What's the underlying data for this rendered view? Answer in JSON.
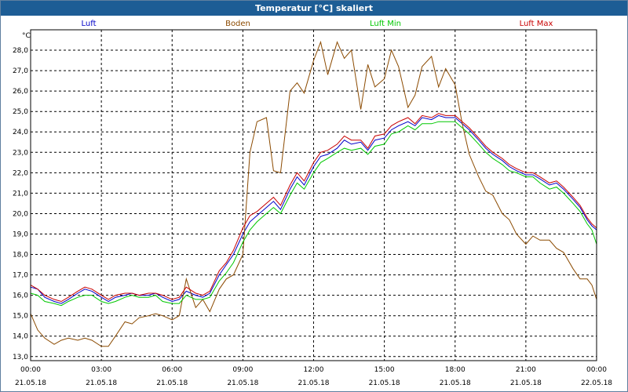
{
  "window": {
    "title": "Temperatur [°C] skaliert"
  },
  "chart_data": {
    "type": "line",
    "title": "Temperatur [°C] skaliert",
    "ylabel": "°C",
    "xlabel": "",
    "ylim": [
      12.8,
      29.0
    ],
    "xlim": [
      0,
      24
    ],
    "grid": true,
    "legend_position": "top",
    "y_ticks": [
      "13,0",
      "14,0",
      "15,0",
      "16,0",
      "17,0",
      "18,0",
      "19,0",
      "20,0",
      "21,0",
      "22,0",
      "23,0",
      "24,0",
      "25,0",
      "26,0",
      "27,0",
      "28,0"
    ],
    "x_ticks": [
      {
        "time": "00:00",
        "date": "21.05.18"
      },
      {
        "time": "03:00",
        "date": "21.05.18"
      },
      {
        "time": "06:00",
        "date": "21.05.18"
      },
      {
        "time": "09:00",
        "date": "21.05.18"
      },
      {
        "time": "12:00",
        "date": "21.05.18"
      },
      {
        "time": "15:00",
        "date": "21.05.18"
      },
      {
        "time": "18:00",
        "date": "21.05.18"
      },
      {
        "time": "21:00",
        "date": "21.05.18"
      },
      {
        "time": "00:00",
        "date": "22.05.18"
      }
    ],
    "series": [
      {
        "name": "Luft",
        "color": "#0000c8",
        "points": [
          [
            0,
            16.4
          ],
          [
            0.3,
            16.3
          ],
          [
            0.6,
            15.9
          ],
          [
            1.0,
            15.7
          ],
          [
            1.3,
            15.6
          ],
          [
            1.6,
            15.8
          ],
          [
            2.0,
            16.1
          ],
          [
            2.3,
            16.3
          ],
          [
            2.6,
            16.2
          ],
          [
            3.0,
            15.9
          ],
          [
            3.3,
            15.7
          ],
          [
            3.6,
            15.9
          ],
          [
            4.0,
            16.0
          ],
          [
            4.3,
            16.1
          ],
          [
            4.6,
            16.0
          ],
          [
            5.0,
            16.0
          ],
          [
            5.3,
            16.1
          ],
          [
            5.6,
            15.9
          ],
          [
            6.0,
            15.7
          ],
          [
            6.3,
            15.8
          ],
          [
            6.6,
            16.2
          ],
          [
            7.0,
            16.0
          ],
          [
            7.3,
            15.9
          ],
          [
            7.6,
            16.1
          ],
          [
            8.0,
            17.0
          ],
          [
            8.3,
            17.5
          ],
          [
            8.6,
            18.0
          ],
          [
            9.0,
            19.0
          ],
          [
            9.3,
            19.6
          ],
          [
            9.6,
            19.9
          ],
          [
            10.0,
            20.3
          ],
          [
            10.3,
            20.6
          ],
          [
            10.6,
            20.2
          ],
          [
            11.0,
            21.2
          ],
          [
            11.3,
            21.8
          ],
          [
            11.6,
            21.4
          ],
          [
            12.0,
            22.3
          ],
          [
            12.3,
            22.8
          ],
          [
            12.6,
            22.9
          ],
          [
            13.0,
            23.2
          ],
          [
            13.3,
            23.6
          ],
          [
            13.6,
            23.4
          ],
          [
            14.0,
            23.5
          ],
          [
            14.3,
            23.1
          ],
          [
            14.6,
            23.6
          ],
          [
            15.0,
            23.7
          ],
          [
            15.3,
            24.1
          ],
          [
            15.6,
            24.3
          ],
          [
            16.0,
            24.5
          ],
          [
            16.3,
            24.3
          ],
          [
            16.6,
            24.7
          ],
          [
            17.0,
            24.6
          ],
          [
            17.3,
            24.8
          ],
          [
            17.6,
            24.7
          ],
          [
            18.0,
            24.7
          ],
          [
            18.3,
            24.4
          ],
          [
            18.6,
            24.1
          ],
          [
            19.0,
            23.6
          ],
          [
            19.3,
            23.2
          ],
          [
            19.6,
            22.9
          ],
          [
            20.0,
            22.6
          ],
          [
            20.3,
            22.3
          ],
          [
            20.6,
            22.1
          ],
          [
            21.0,
            21.9
          ],
          [
            21.3,
            21.9
          ],
          [
            21.6,
            21.7
          ],
          [
            22.0,
            21.4
          ],
          [
            22.3,
            21.5
          ],
          [
            22.6,
            21.2
          ],
          [
            23.0,
            20.7
          ],
          [
            23.3,
            20.3
          ],
          [
            23.6,
            19.7
          ],
          [
            23.8,
            19.4
          ],
          [
            24.0,
            19.2
          ]
        ]
      },
      {
        "name": "Boden",
        "color": "#8b4a00",
        "points": [
          [
            0,
            15.1
          ],
          [
            0.3,
            14.3
          ],
          [
            0.6,
            13.9
          ],
          [
            1.0,
            13.6
          ],
          [
            1.3,
            13.8
          ],
          [
            1.6,
            13.9
          ],
          [
            2.0,
            13.8
          ],
          [
            2.3,
            13.9
          ],
          [
            2.6,
            13.8
          ],
          [
            3.0,
            13.5
          ],
          [
            3.3,
            13.5
          ],
          [
            3.6,
            14.0
          ],
          [
            4.0,
            14.7
          ],
          [
            4.3,
            14.6
          ],
          [
            4.6,
            14.9
          ],
          [
            5.0,
            15.0
          ],
          [
            5.3,
            15.1
          ],
          [
            5.6,
            15.0
          ],
          [
            6.0,
            14.8
          ],
          [
            6.3,
            15.0
          ],
          [
            6.6,
            16.8
          ],
          [
            7.0,
            15.4
          ],
          [
            7.3,
            15.8
          ],
          [
            7.6,
            15.2
          ],
          [
            8.0,
            16.3
          ],
          [
            8.3,
            16.8
          ],
          [
            8.6,
            17.0
          ],
          [
            9.0,
            18.0
          ],
          [
            9.3,
            23.0
          ],
          [
            9.6,
            24.5
          ],
          [
            10.0,
            24.7
          ],
          [
            10.3,
            22.1
          ],
          [
            10.6,
            22.0
          ],
          [
            11.0,
            26.0
          ],
          [
            11.3,
            26.4
          ],
          [
            11.6,
            25.9
          ],
          [
            12.0,
            27.5
          ],
          [
            12.3,
            28.4
          ],
          [
            12.6,
            26.8
          ],
          [
            13.0,
            28.4
          ],
          [
            13.3,
            27.6
          ],
          [
            13.6,
            28.0
          ],
          [
            14.0,
            25.1
          ],
          [
            14.3,
            27.3
          ],
          [
            14.6,
            26.2
          ],
          [
            15.0,
            26.6
          ],
          [
            15.3,
            28.0
          ],
          [
            15.6,
            27.2
          ],
          [
            16.0,
            25.2
          ],
          [
            16.3,
            25.8
          ],
          [
            16.6,
            27.2
          ],
          [
            17.0,
            27.7
          ],
          [
            17.3,
            26.2
          ],
          [
            17.6,
            27.1
          ],
          [
            18.0,
            26.3
          ],
          [
            18.3,
            24.4
          ],
          [
            18.6,
            22.9
          ],
          [
            19.0,
            21.8
          ],
          [
            19.3,
            21.1
          ],
          [
            19.6,
            20.9
          ],
          [
            20.0,
            20.0
          ],
          [
            20.3,
            19.7
          ],
          [
            20.6,
            19.0
          ],
          [
            21.0,
            18.5
          ],
          [
            21.3,
            18.9
          ],
          [
            21.6,
            18.7
          ],
          [
            22.0,
            18.7
          ],
          [
            22.3,
            18.3
          ],
          [
            22.6,
            18.1
          ],
          [
            23.0,
            17.3
          ],
          [
            23.3,
            16.8
          ],
          [
            23.6,
            16.8
          ],
          [
            23.8,
            16.5
          ],
          [
            24.0,
            15.8
          ]
        ]
      },
      {
        "name": "Luft Min",
        "color": "#00c800",
        "points": [
          [
            0,
            16.1
          ],
          [
            0.3,
            16.0
          ],
          [
            0.6,
            15.7
          ],
          [
            1.0,
            15.6
          ],
          [
            1.3,
            15.5
          ],
          [
            1.6,
            15.7
          ],
          [
            2.0,
            15.9
          ],
          [
            2.3,
            16.0
          ],
          [
            2.6,
            16.0
          ],
          [
            3.0,
            15.7
          ],
          [
            3.3,
            15.6
          ],
          [
            3.6,
            15.7
          ],
          [
            4.0,
            15.9
          ],
          [
            4.3,
            16.0
          ],
          [
            4.6,
            15.9
          ],
          [
            5.0,
            15.9
          ],
          [
            5.3,
            16.0
          ],
          [
            5.6,
            15.7
          ],
          [
            6.0,
            15.6
          ],
          [
            6.3,
            15.6
          ],
          [
            6.6,
            16.0
          ],
          [
            7.0,
            15.8
          ],
          [
            7.3,
            15.8
          ],
          [
            7.6,
            15.9
          ],
          [
            8.0,
            16.7
          ],
          [
            8.3,
            17.1
          ],
          [
            8.6,
            17.6
          ],
          [
            9.0,
            18.6
          ],
          [
            9.3,
            19.2
          ],
          [
            9.6,
            19.6
          ],
          [
            10.0,
            20.0
          ],
          [
            10.3,
            20.3
          ],
          [
            10.6,
            20.0
          ],
          [
            11.0,
            20.9
          ],
          [
            11.3,
            21.5
          ],
          [
            11.6,
            21.2
          ],
          [
            12.0,
            22.0
          ],
          [
            12.3,
            22.5
          ],
          [
            12.6,
            22.7
          ],
          [
            13.0,
            23.0
          ],
          [
            13.3,
            23.2
          ],
          [
            13.6,
            23.1
          ],
          [
            14.0,
            23.2
          ],
          [
            14.3,
            22.9
          ],
          [
            14.6,
            23.3
          ],
          [
            15.0,
            23.4
          ],
          [
            15.3,
            23.9
          ],
          [
            15.6,
            24.0
          ],
          [
            16.0,
            24.3
          ],
          [
            16.3,
            24.1
          ],
          [
            16.6,
            24.4
          ],
          [
            17.0,
            24.4
          ],
          [
            17.3,
            24.5
          ],
          [
            17.6,
            24.5
          ],
          [
            18.0,
            24.5
          ],
          [
            18.3,
            24.2
          ],
          [
            18.6,
            23.9
          ],
          [
            19.0,
            23.4
          ],
          [
            19.3,
            23.0
          ],
          [
            19.6,
            22.7
          ],
          [
            20.0,
            22.4
          ],
          [
            20.3,
            22.1
          ],
          [
            20.6,
            22.0
          ],
          [
            21.0,
            21.8
          ],
          [
            21.3,
            21.8
          ],
          [
            21.6,
            21.5
          ],
          [
            22.0,
            21.2
          ],
          [
            22.3,
            21.3
          ],
          [
            22.6,
            21.0
          ],
          [
            23.0,
            20.5
          ],
          [
            23.3,
            20.1
          ],
          [
            23.6,
            19.5
          ],
          [
            23.8,
            19.2
          ],
          [
            24.0,
            18.5
          ]
        ]
      },
      {
        "name": "Luft Max",
        "color": "#c80000",
        "points": [
          [
            0,
            16.5
          ],
          [
            0.3,
            16.3
          ],
          [
            0.6,
            16.0
          ],
          [
            1.0,
            15.8
          ],
          [
            1.3,
            15.7
          ],
          [
            1.6,
            15.9
          ],
          [
            2.0,
            16.2
          ],
          [
            2.3,
            16.4
          ],
          [
            2.6,
            16.3
          ],
          [
            3.0,
            16.0
          ],
          [
            3.3,
            15.8
          ],
          [
            3.6,
            16.0
          ],
          [
            4.0,
            16.1
          ],
          [
            4.3,
            16.1
          ],
          [
            4.6,
            16.0
          ],
          [
            5.0,
            16.1
          ],
          [
            5.3,
            16.1
          ],
          [
            5.6,
            16.0
          ],
          [
            6.0,
            15.8
          ],
          [
            6.3,
            15.9
          ],
          [
            6.6,
            16.4
          ],
          [
            7.0,
            16.1
          ],
          [
            7.3,
            16.0
          ],
          [
            7.6,
            16.2
          ],
          [
            8.0,
            17.2
          ],
          [
            8.3,
            17.6
          ],
          [
            8.6,
            18.2
          ],
          [
            9.0,
            19.3
          ],
          [
            9.3,
            19.9
          ],
          [
            9.6,
            20.1
          ],
          [
            10.0,
            20.5
          ],
          [
            10.3,
            20.8
          ],
          [
            10.6,
            20.4
          ],
          [
            11.0,
            21.4
          ],
          [
            11.3,
            22.0
          ],
          [
            11.6,
            21.6
          ],
          [
            12.0,
            22.5
          ],
          [
            12.3,
            23.0
          ],
          [
            12.6,
            23.1
          ],
          [
            13.0,
            23.4
          ],
          [
            13.3,
            23.8
          ],
          [
            13.6,
            23.6
          ],
          [
            14.0,
            23.6
          ],
          [
            14.3,
            23.2
          ],
          [
            14.6,
            23.8
          ],
          [
            15.0,
            23.9
          ],
          [
            15.3,
            24.3
          ],
          [
            15.6,
            24.5
          ],
          [
            16.0,
            24.7
          ],
          [
            16.3,
            24.4
          ],
          [
            16.6,
            24.8
          ],
          [
            17.0,
            24.7
          ],
          [
            17.3,
            24.9
          ],
          [
            17.6,
            24.8
          ],
          [
            18.0,
            24.8
          ],
          [
            18.3,
            24.5
          ],
          [
            18.6,
            24.2
          ],
          [
            19.0,
            23.7
          ],
          [
            19.3,
            23.3
          ],
          [
            19.6,
            23.0
          ],
          [
            20.0,
            22.7
          ],
          [
            20.3,
            22.4
          ],
          [
            20.6,
            22.2
          ],
          [
            21.0,
            22.0
          ],
          [
            21.3,
            22.0
          ],
          [
            21.6,
            21.8
          ],
          [
            22.0,
            21.5
          ],
          [
            22.3,
            21.6
          ],
          [
            22.6,
            21.3
          ],
          [
            23.0,
            20.8
          ],
          [
            23.3,
            20.4
          ],
          [
            23.6,
            19.8
          ],
          [
            23.8,
            19.5
          ],
          [
            24.0,
            19.3
          ]
        ]
      }
    ]
  }
}
